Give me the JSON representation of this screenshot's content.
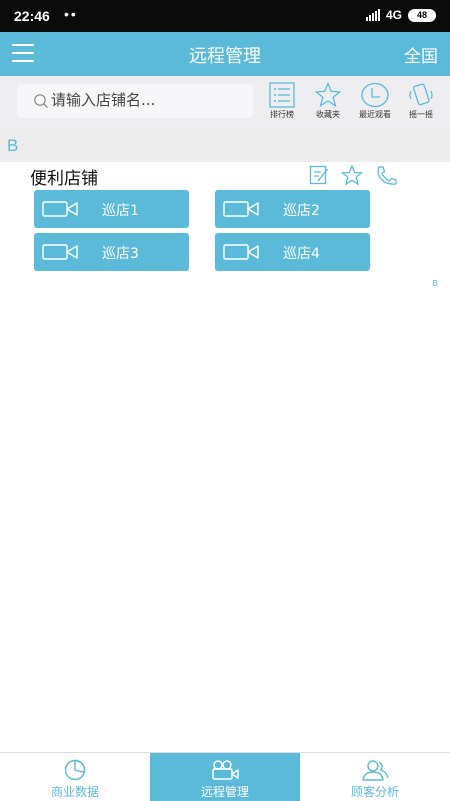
{
  "status_bar": {
    "time": "22:46",
    "dots": "••",
    "network": "4G",
    "battery": "48"
  },
  "header": {
    "title": "远程管理",
    "region": "全国"
  },
  "search": {
    "placeholder": "请输入店铺名..."
  },
  "tools": [
    {
      "label": "排行榜",
      "icon": "ranking-list-icon"
    },
    {
      "label": "收藏夹",
      "icon": "star-icon"
    },
    {
      "label": "最近观看",
      "icon": "clock-icon"
    },
    {
      "label": "摇一摇",
      "icon": "shake-phone-icon"
    }
  ],
  "index": {
    "letter": "B",
    "side_letter": "B"
  },
  "store": {
    "name": "便利店铺",
    "actions": [
      "edit-icon",
      "star-icon",
      "phone-icon"
    ],
    "cameras": [
      "巡店1",
      "巡店2",
      "巡店3",
      "巡店4"
    ]
  },
  "nav": {
    "items": [
      {
        "label": "商业数据",
        "icon": "pie-chart-icon",
        "active": false
      },
      {
        "label": "远程管理",
        "icon": "video-camera-icon",
        "active": true
      },
      {
        "label": "顾客分析",
        "icon": "customers-icon",
        "active": false
      }
    ]
  },
  "colors": {
    "accent": "#5bbad9",
    "status_bar": "#0a0a0a",
    "toolbar_bg": "#eeeef0",
    "index_bg": "#ececec"
  }
}
